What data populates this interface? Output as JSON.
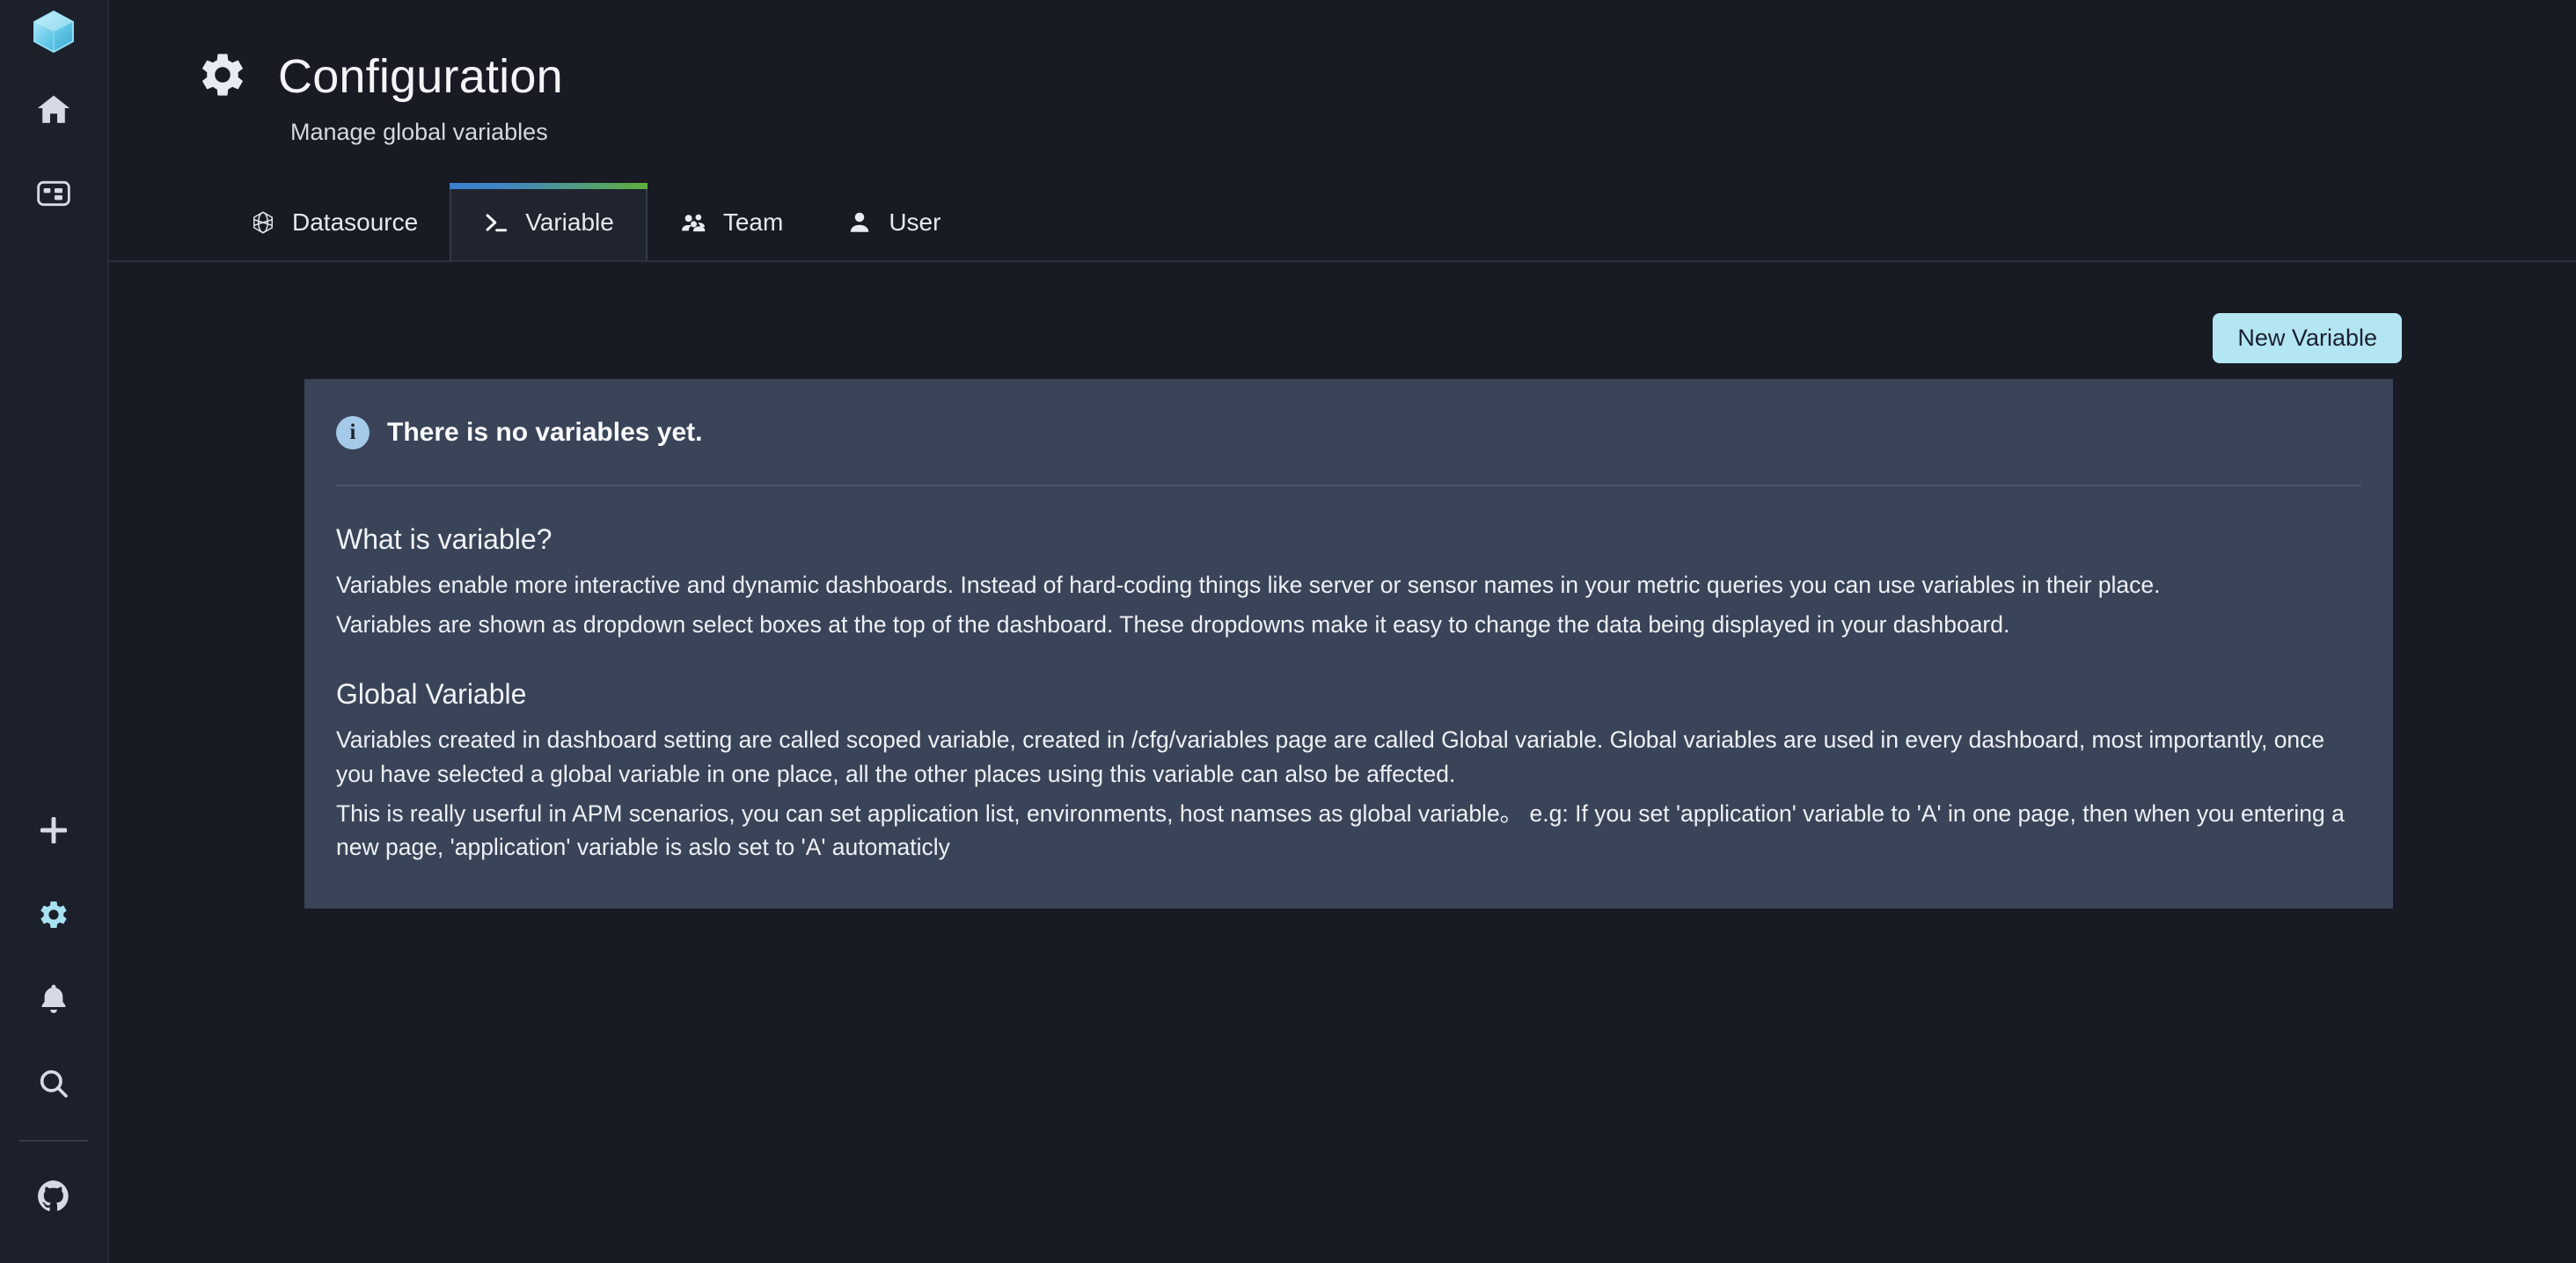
{
  "sidebar": {
    "logo": {
      "icon": "gem-logo-icon",
      "name": "app-logo"
    },
    "top_items": [
      {
        "icon": "home-icon",
        "name": "sidebar-item-home"
      },
      {
        "icon": "dashboard-grid-icon",
        "name": "sidebar-item-dashboards"
      }
    ],
    "bottom_items": [
      {
        "icon": "plus-icon",
        "name": "sidebar-item-new",
        "active": false
      },
      {
        "icon": "gear-icon",
        "name": "sidebar-item-configuration",
        "active": true
      },
      {
        "icon": "bell-icon",
        "name": "sidebar-item-alerting",
        "active": false
      },
      {
        "icon": "search-icon",
        "name": "sidebar-item-search",
        "active": false
      },
      {
        "icon": "github-icon",
        "name": "sidebar-item-github",
        "active": false
      }
    ]
  },
  "header": {
    "icon": "gear-icon",
    "title": "Configuration",
    "subtitle": "Manage global variables"
  },
  "tabs": [
    {
      "label": "Datasource",
      "icon": "hexagon-datasource-icon",
      "active": false
    },
    {
      "label": "Variable",
      "icon": "terminal-prompt-icon",
      "active": true
    },
    {
      "label": "Team",
      "icon": "team-people-icon",
      "active": false
    },
    {
      "label": "User",
      "icon": "user-person-icon",
      "active": false
    }
  ],
  "toolbar": {
    "new_variable_label": "New Variable"
  },
  "panel": {
    "alert": {
      "icon": "info-icon",
      "icon_glyph": "i",
      "text": "There is no variables yet."
    },
    "sections": [
      {
        "heading": "What is variable?",
        "paragraphs": [
          "Variables enable more interactive and dynamic dashboards. Instead of hard-coding things like server or sensor names in your metric queries you can use variables in their place.",
          "Variables are shown as dropdown select boxes at the top of the dashboard. These dropdowns make it easy to change the data being displayed in your dashboard."
        ]
      },
      {
        "heading": "Global Variable",
        "paragraphs": [
          "Variables created in dashboard setting are called scoped variable, created in /cfg/variables page are called Global variable. Global variables are used in every dashboard, most importantly, once you have selected a global variable in one place, all the other places using this variable can also be affected.",
          "This is really userful in APM scenarios, you can set application list, environments, host namses as global variable。 e.g: If you set 'application' variable to 'A' in one page, then when you entering a new page, 'application' variable is aslo set to 'A' automaticly"
        ]
      }
    ]
  },
  "colors": {
    "app_background": "#181b24",
    "sidebar_background": "#1c202b",
    "panel_background": "#394458",
    "accent_button": "#b3e6f2",
    "accent_active_icon": "#a8e2f0",
    "tab_gradient_start": "#3b7fd0",
    "tab_gradient_end": "#5fb03a",
    "info_icon": "#a5c9e8"
  }
}
